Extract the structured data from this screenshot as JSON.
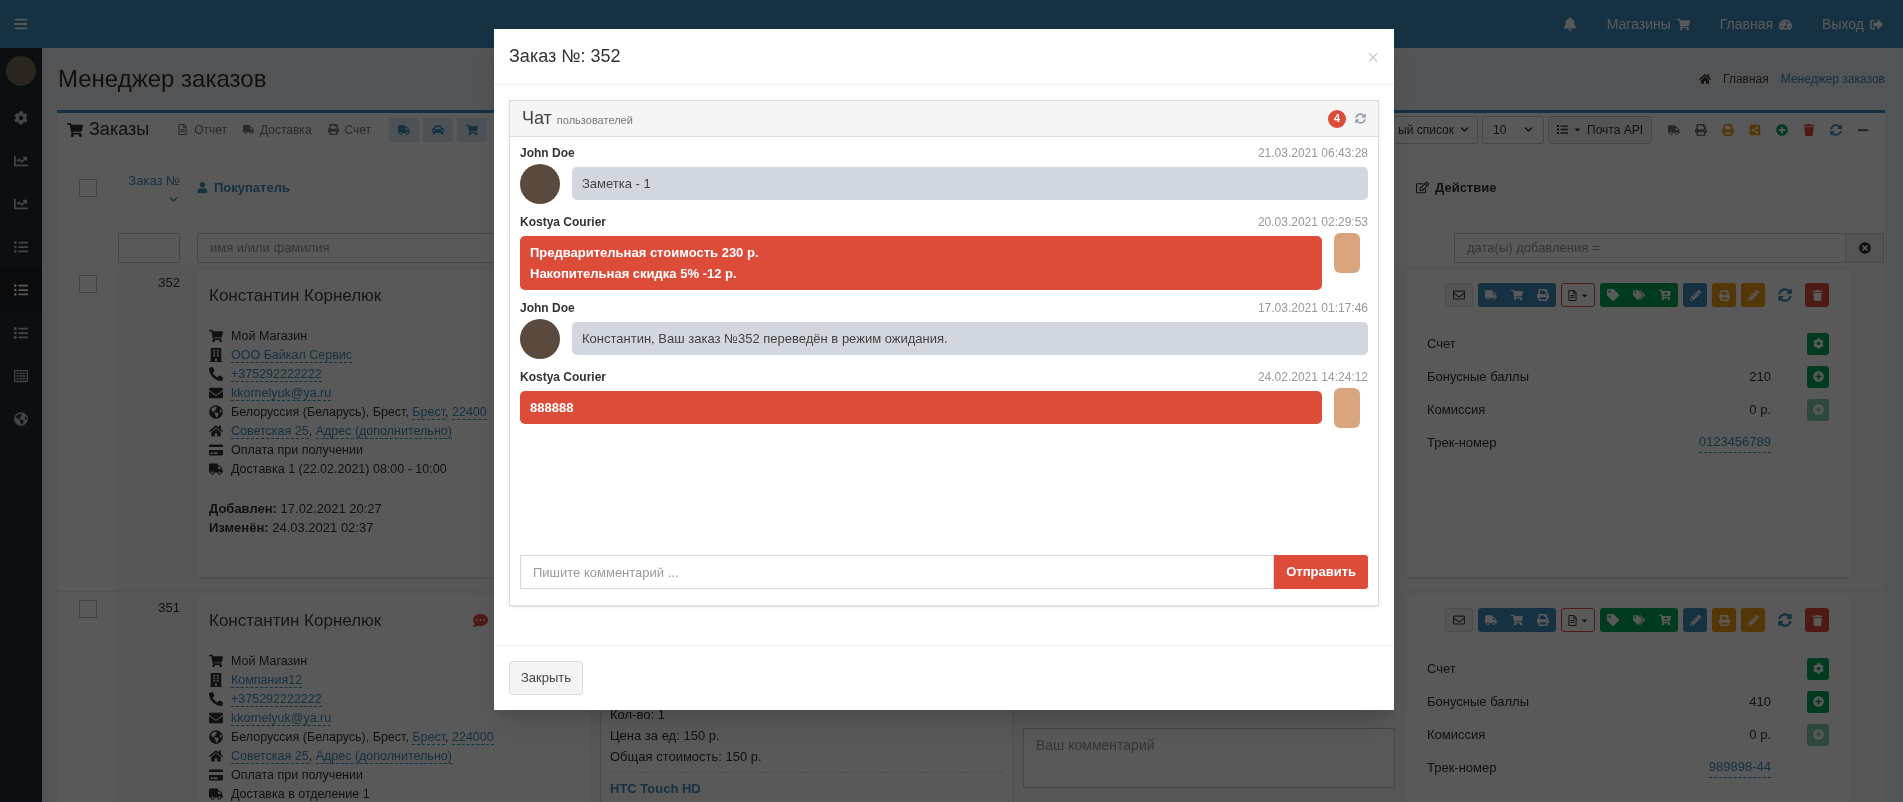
{
  "topbar": {
    "links": [
      {
        "label": "Магазины"
      },
      {
        "label": "Главная"
      },
      {
        "label": "Выход"
      }
    ]
  },
  "sidebar": {
    "items": [
      {
        "selected": false
      },
      {
        "selected": false
      },
      {
        "selected": false
      },
      {
        "selected": false
      },
      {
        "selected": true
      },
      {
        "selected": false
      },
      {
        "selected": false
      },
      {
        "selected": false
      }
    ]
  },
  "page": {
    "title": "Менеджер заказов",
    "breadcrumb": [
      "Главная",
      "Менеджер заказов"
    ]
  },
  "orders_box": {
    "title": "Заказы",
    "toolbar": [
      "Отчет",
      "Доставка",
      "Счет"
    ],
    "list_select": "ый список",
    "per_page": "10",
    "mail_button": "Почта API"
  },
  "table": {
    "columns": [
      "Заказ №",
      "Покупатель",
      "Действие"
    ],
    "select_all_checked": false,
    "filters": {
      "name_placeholder": "имя и/или фамилия",
      "date_placeholder": "дата(ы) добавления ="
    },
    "rows": [
      {
        "number": "352",
        "checked": false,
        "customer": "Константин Корнелюк",
        "has_chat": false,
        "details": [
          {
            "kind": "shop",
            "parts": [
              {
                "text": "Мой Магазин"
              }
            ]
          },
          {
            "kind": "company",
            "parts": [
              {
                "link": "ООО Байкал Сервис"
              }
            ]
          },
          {
            "kind": "phone",
            "parts": [
              {
                "link": "+375292222222"
              }
            ]
          },
          {
            "kind": "email",
            "parts": [
              {
                "link": "kkornelyuk@ya.ru"
              }
            ]
          },
          {
            "kind": "location",
            "parts": [
              {
                "text": "Белоруссия (Беларусь), Брест, "
              },
              {
                "link": "Брест"
              },
              {
                "text": ", "
              },
              {
                "link": "22400"
              }
            ]
          },
          {
            "kind": "home",
            "parts": [
              {
                "link": "Советская 25"
              },
              {
                "text": ", "
              },
              {
                "link": "Адрес (дополнительно)"
              }
            ]
          },
          {
            "kind": "payment",
            "parts": [
              {
                "text": "Оплата при получении"
              }
            ]
          },
          {
            "kind": "delivery",
            "parts": [
              {
                "text": "Доставка 1 (22.02.2021) 08:00 - 10:00"
              }
            ]
          }
        ],
        "added": "**Добавлен:** 17.02.2021 20:27",
        "changed": "**Изменён:** 24.03.2021 02:37",
        "info": [
          {
            "kind": "settings",
            "label": "Счет"
          },
          {
            "kind": "add",
            "label": "Бонусные баллы",
            "value": "210",
            "disabled": false
          },
          {
            "kind": "add",
            "label": "Комиссия",
            "value": "0 р.",
            "disabled": true
          },
          {
            "kind": "link",
            "label": "Трек-номер",
            "value": "0123456789"
          }
        ]
      },
      {
        "number": "351",
        "checked": false,
        "customer": "Константин Корнелюк",
        "has_chat": true,
        "details": [
          {
            "kind": "shop",
            "parts": [
              {
                "text": "Мой Магазин"
              }
            ]
          },
          {
            "kind": "company",
            "parts": [
              {
                "link": "Компания12"
              }
            ]
          },
          {
            "kind": "phone",
            "parts": [
              {
                "link": "+375292222222"
              }
            ]
          },
          {
            "kind": "email",
            "parts": [
              {
                "link": "kkornelyuk@ya.ru"
              }
            ]
          },
          {
            "kind": "location",
            "parts": [
              {
                "text": "Белоруссия (Беларусь), Брест, "
              },
              {
                "link": "Брест"
              },
              {
                "text": ", "
              },
              {
                "link": "224000"
              }
            ]
          },
          {
            "kind": "home",
            "parts": [
              {
                "link": "Советская 25"
              },
              {
                "text": ", "
              },
              {
                "link": "Адрес (дополнительно)"
              }
            ]
          },
          {
            "kind": "payment",
            "parts": [
              {
                "text": "Оплата при получении"
              }
            ]
          },
          {
            "kind": "delivery",
            "parts": [
              {
                "text": "Доставка в отделение 1"
              }
            ]
          }
        ],
        "product_lines": [
          "Кол-во: 1",
          "Цена за ед: 150 р.",
          "Общая стоимость: 150 р."
        ],
        "product_link": "HTC Touch HD",
        "comment_placeholder": "Ваш комментарий",
        "info": [
          {
            "kind": "settings",
            "label": "Счет"
          },
          {
            "kind": "add",
            "label": "Бонусные баллы",
            "value": "410",
            "disabled": false
          },
          {
            "kind": "add",
            "label": "Комиссия",
            "value": "0 р.",
            "disabled": true
          },
          {
            "kind": "link",
            "label": "Трек-номер",
            "value": "989898-44"
          }
        ]
      }
    ]
  },
  "modal": {
    "title": "Заказ №: 352",
    "close": "×",
    "chat": {
      "title": "Чат",
      "subtitle": "пользователей",
      "count": "4",
      "messages": [
        {
          "kind": "left",
          "author": "John Doe",
          "time": "21.03.2021 06:43:28",
          "lines": [
            "Заметка - 1"
          ]
        },
        {
          "kind": "right",
          "author": "Kostya Courier",
          "time": "20.03.2021 02:29:53",
          "lines": [
            "Предварительная стоимость 230 р.",
            "Накопительная скидка 5% -12 р."
          ]
        },
        {
          "kind": "left",
          "author": "John Doe",
          "time": "17.03.2021 01:17:46",
          "lines": [
            "Константин, Ваш заказ №352 переведён в режим ожидания."
          ]
        },
        {
          "kind": "right",
          "author": "Kostya Courier",
          "time": "24.02.2021 14:24:12",
          "lines": [
            "888888"
          ]
        }
      ],
      "input_placeholder": "Пишите комментарий ...",
      "send": "Отправить"
    },
    "footer_button": "Закрыть"
  }
}
